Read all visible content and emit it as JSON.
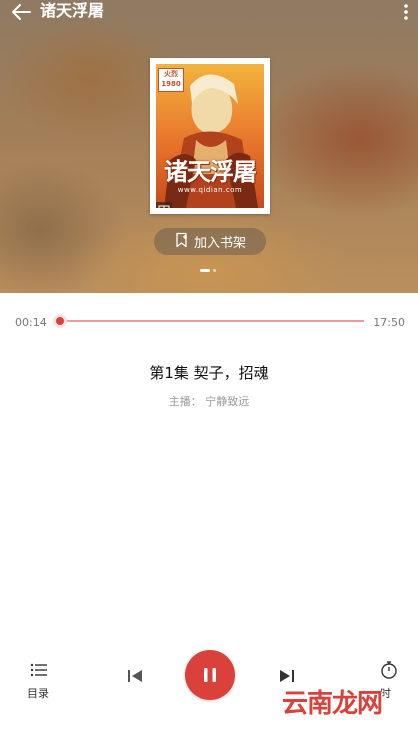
{
  "header": {
    "title": "诸天浮屠"
  },
  "cover": {
    "badge_line1": "火烈",
    "badge_line2": "1980",
    "title": "诸天浮屠",
    "url": "www.qidian.com"
  },
  "add_shelf_label": "加入书架",
  "player": {
    "current_time": "00:14",
    "total_time": "17:50",
    "progress": 0.013,
    "episode_title": "第1集 契子，招魂",
    "host": "主播： 宁静致远"
  },
  "controls": {
    "catalog_label": "目录",
    "timer_label": "时"
  },
  "watermark": "云南龙网",
  "colors": {
    "accent": "#d9413a",
    "track": "#ef9a9a"
  }
}
